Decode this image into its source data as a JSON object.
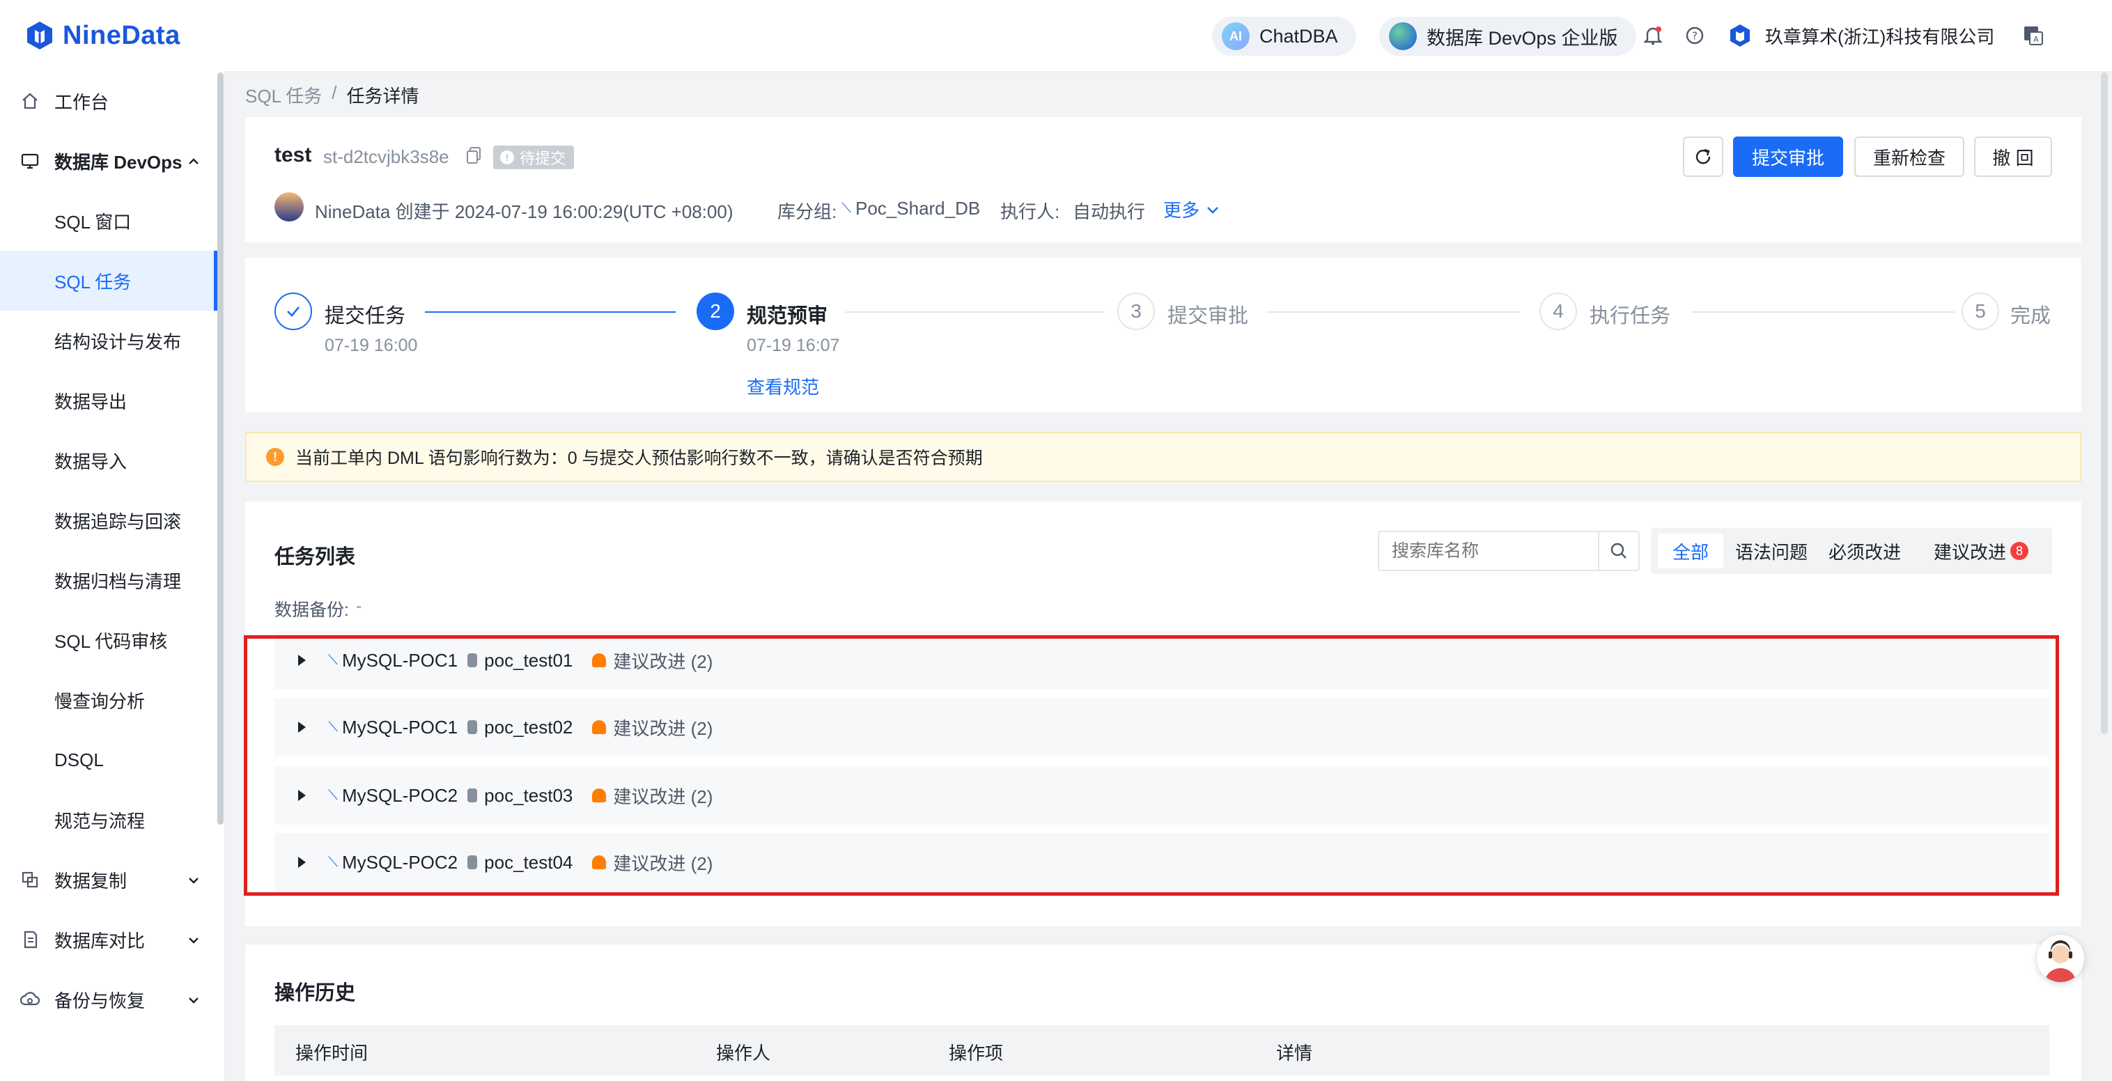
{
  "app": {
    "brand": "NineData"
  },
  "topbar": {
    "chatdba": "ChatDBA",
    "devops": "数据库 DevOps 企业版",
    "company": "玖章算术(浙江)科技有限公司"
  },
  "sidebar": {
    "items": [
      {
        "label": "工作台",
        "icon": "home-icon"
      },
      {
        "label": "数据库 DevOps",
        "icon": "monitor-icon"
      },
      {
        "label": "SQL 窗口"
      },
      {
        "label": "SQL 任务"
      },
      {
        "label": "结构设计与发布"
      },
      {
        "label": "数据导出"
      },
      {
        "label": "数据导入"
      },
      {
        "label": "数据追踪与回滚"
      },
      {
        "label": "数据归档与清理"
      },
      {
        "label": "SQL 代码审核"
      },
      {
        "label": "慢查询分析"
      },
      {
        "label": "DSQL"
      },
      {
        "label": "规范与流程"
      },
      {
        "label": "数据复制",
        "icon": "replicate-icon"
      },
      {
        "label": "数据库对比",
        "icon": "compare-icon"
      },
      {
        "label": "备份与恢复",
        "icon": "backup-icon"
      }
    ]
  },
  "breadcrumb": {
    "parent": "SQL 任务",
    "sep": "/",
    "current": "任务详情"
  },
  "task": {
    "name": "test",
    "id": "st-d2tcvjbk3s8e",
    "status": "待提交",
    "creator_line": "NineData 创建于 2024-07-19 16:00:29(UTC +08:00)",
    "group_label": "库分组:",
    "group_value": "Poc_Shard_DB",
    "executor_label": "执行人:",
    "executor_value": "自动执行",
    "more": "更多"
  },
  "actions": {
    "submit": "提交审批",
    "recheck": "重新检查",
    "revoke": "撤 回"
  },
  "steps": [
    {
      "num": "✓",
      "label": "提交任务",
      "time": "07-19 16:00"
    },
    {
      "num": "2",
      "label": "规范预审",
      "time": "07-19 16:07",
      "link": "查看规范"
    },
    {
      "num": "3",
      "label": "提交审批"
    },
    {
      "num": "4",
      "label": "执行任务"
    },
    {
      "num": "5",
      "label": "完成"
    }
  ],
  "alert": {
    "text": "当前工单内 DML 语句影响行数为：0 与提交人预估影响行数不一致，请确认是否符合预期"
  },
  "task_list": {
    "title": "任务列表",
    "search_placeholder": "搜索库名称",
    "tabs": [
      "全部",
      "语法问题",
      "必须改进",
      "建议改进"
    ],
    "suggest_count": "8",
    "backup_label": "数据备份:",
    "backup_value": "-",
    "rows": [
      {
        "instance": "MySQL-POC1",
        "db": "poc_test01",
        "issue": "建议改进 (2)"
      },
      {
        "instance": "MySQL-POC1",
        "db": "poc_test02",
        "issue": "建议改进 (2)"
      },
      {
        "instance": "MySQL-POC2",
        "db": "poc_test03",
        "issue": "建议改进 (2)"
      },
      {
        "instance": "MySQL-POC2",
        "db": "poc_test04",
        "issue": "建议改进 (2)"
      }
    ]
  },
  "history": {
    "title": "操作历史",
    "columns": [
      "操作时间",
      "操作人",
      "操作项",
      "详情"
    ]
  },
  "colors": {
    "primary": "#1a6cf6",
    "alert_bg": "#fffbe8",
    "highlight": "#e02020",
    "warn": "#ff7d00"
  }
}
